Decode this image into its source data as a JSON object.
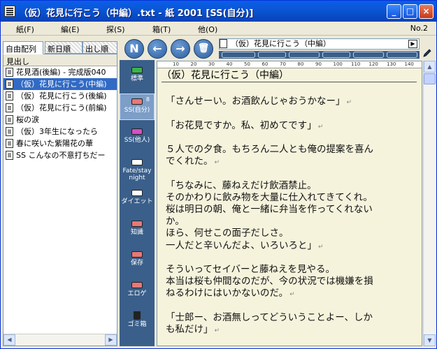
{
  "window": {
    "title": "（仮）花見に行こう（中編）.txt - 紙 2001 [SS(自分)]",
    "min_label": "_",
    "max_label": "□",
    "close_label": "×"
  },
  "menu": {
    "items": [
      "紙(F)",
      "編(E)",
      "探(S)",
      "箱(T)",
      "他(O)"
    ],
    "page_indicator": "No.2"
  },
  "left_panel": {
    "tabs": [
      "自由配列",
      "新日順",
      "出し順"
    ],
    "list_header": "見出し",
    "items": [
      {
        "label": "花見酒(後編) - 完成版040",
        "selected": false
      },
      {
        "label": "（仮）花見に行こう(中編)",
        "selected": true
      },
      {
        "label": "（仮）花見に行こう(後編)",
        "selected": false
      },
      {
        "label": "（仮）花見に行こう(前編)",
        "selected": false
      },
      {
        "label": "桜の涙",
        "selected": false
      },
      {
        "label": "（仮）3年生になったら",
        "selected": false
      },
      {
        "label": "春に咲いた紫陽花の華",
        "selected": false
      },
      {
        "label": "SS こんなの不意打ちだー",
        "selected": false
      }
    ],
    "scroll_left": "◀",
    "scroll_right": "▶"
  },
  "toolbar": {
    "new_label": "N",
    "back_label": "←",
    "forward_label": "→",
    "trash_label": "🗑",
    "dropdown_label": "▶"
  },
  "categories": [
    {
      "label": "標準",
      "color": "#39b54a",
      "count": ""
    },
    {
      "label": "SS(自分)",
      "color": "#e87878",
      "count": "8"
    },
    {
      "label": "SS(他人)",
      "color": "#d64fc1",
      "count": ""
    },
    {
      "label": "Fate/stay night",
      "color": "#ffffff",
      "count": ""
    },
    {
      "label": "ダイエット",
      "color": "#ffffff",
      "count": ""
    },
    {
      "label": "知識",
      "color": "#e87878",
      "count": ""
    },
    {
      "label": "保存",
      "color": "#e87878",
      "count": ""
    },
    {
      "label": "エロゲ",
      "color": "#e87878",
      "count": ""
    },
    {
      "label": "ゴミ箱",
      "color": "#222222",
      "count": ""
    }
  ],
  "document": {
    "title_box": "（仮）花見に行こう（中編）",
    "ruler_numbers": [
      "10",
      "20",
      "30",
      "40",
      "50",
      "60",
      "70",
      "80",
      "90",
      "100",
      "110",
      "120",
      "130",
      "140"
    ],
    "heading": "（仮）花見に行こう（中編）",
    "lines": [
      "",
      "「さんせーい。お酒飲んじゃおうかなー」",
      "",
      "「お花見ですか。私、初めてです」",
      "",
      "５人での夕食。もちろん二人とも俺の提案を喜ん",
      "でくれた。",
      "",
      "「ちなみに、藤ねえだけ飲酒禁止。",
      "そのかわりに飲み物を大量に仕入れてきてくれ。",
      "桜は明日の朝、俺と一緒に弁当を作ってくれない",
      "か。",
      "ほら、何せこの面子だしさ。",
      "一人だと辛いんだよ、いろいろと」",
      "",
      "そういってセイバーと藤ねえを見やる。",
      "本当は桜も仲間なのだが、今の状況では機嫌を損",
      "ねるわけにはいかないのだ。",
      "",
      "「士郎ー、お酒無しってどういうことよー、しか",
      "も私だけ」"
    ],
    "line_marks": [
      false,
      true,
      false,
      true,
      false,
      false,
      true,
      false,
      false,
      false,
      false,
      false,
      false,
      true,
      false,
      false,
      false,
      true,
      false,
      false,
      true
    ]
  },
  "scrollbar": {
    "up": "▲",
    "down": "▼"
  },
  "colors": {
    "title_bar": "#0b57d6",
    "category_bg": "#3a5f8a",
    "editor_bg": "#f5f3dc",
    "selection": "#316ac5"
  }
}
